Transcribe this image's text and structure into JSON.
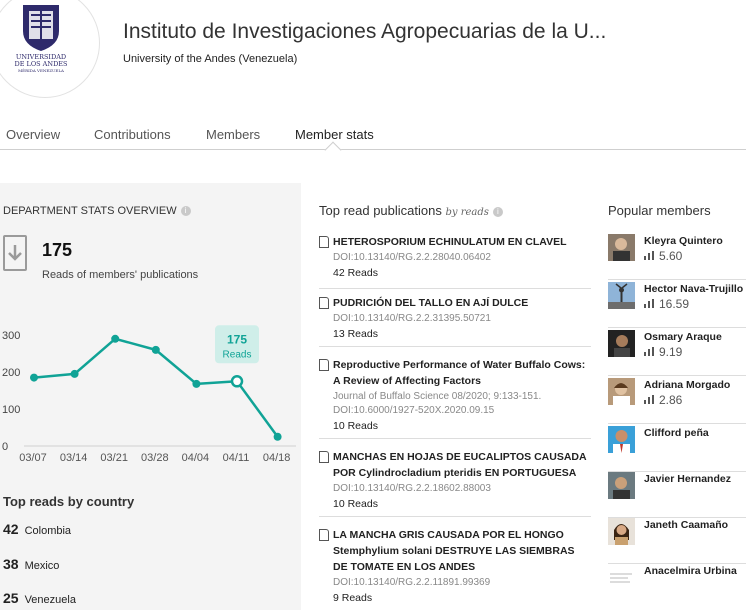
{
  "header": {
    "title": "Instituto de Investigaciones Agropecuarias de la U...",
    "subtitle": "University of the Andes (Venezuela)",
    "logo_text": [
      "UNIVERSIDAD",
      "DE LOS ANDES",
      "MÉRIDA VENEZUELA"
    ]
  },
  "tabs": [
    {
      "label": "Overview"
    },
    {
      "label": "Contributions"
    },
    {
      "label": "Members"
    },
    {
      "label": "Member stats",
      "active": true
    }
  ],
  "stats": {
    "heading": "DEPARTMENT STATS OVERVIEW",
    "total": "175",
    "total_label": "Reads of members' publications"
  },
  "chart_data": {
    "type": "line",
    "categories": [
      "03/07",
      "03/14",
      "03/21",
      "03/28",
      "04/04",
      "04/11",
      "04/18"
    ],
    "x": [
      0,
      1,
      2,
      3,
      4,
      5,
      6,
      7,
      8
    ],
    "values": [
      185,
      195,
      290,
      260,
      168,
      175,
      25
    ],
    "points_x": [
      0,
      1,
      2,
      3,
      4,
      5,
      6
    ],
    "yticks": [
      0,
      100,
      200,
      300
    ],
    "ylim": [
      0,
      330
    ],
    "highlight": {
      "index": 5,
      "value": "175",
      "label": "Reads"
    },
    "line_color": "#10a396"
  },
  "countries": {
    "heading": "Top reads by country",
    "items": [
      {
        "count": "42",
        "name": "Colombia"
      },
      {
        "count": "38",
        "name": "Mexico"
      },
      {
        "count": "25",
        "name": "Venezuela"
      }
    ]
  },
  "publications": {
    "heading": "Top read publications",
    "heading_sub": "by reads",
    "items": [
      {
        "title": "HETEROSPORIUM ECHINULATUM EN CLAVEL",
        "meta": "DOI:10.13140/RG.2.2.28040.06402",
        "reads": "42 Reads"
      },
      {
        "title": "PUDRICIÓN DEL TALLO EN AJÍ DULCE",
        "meta": "DOI:10.13140/RG.2.2.31395.50721",
        "reads": "13 Reads"
      },
      {
        "title": "Reproductive Performance of Water Buffalo Cows: A Review of Affecting Factors",
        "meta": "Journal of Buffalo Science 08/2020; 9:133-151. DOI:10.6000/1927-520X.2020.09.15",
        "reads": "10 Reads"
      },
      {
        "title": "MANCHAS EN HOJAS DE EUCALIPTOS CAUSADA POR Cylindrocladium pteridis EN PORTUGUESA",
        "meta": "DOI:10.13140/RG.2.2.18602.88003",
        "reads": "10 Reads"
      },
      {
        "title": "LA MANCHA GRIS CAUSADA POR EL HONGO Stemphylium solani DESTRUYE LAS SIEMBRAS DE TOMATE EN LOS ANDES",
        "meta": "DOI:10.13140/RG.2.2.11891.99369",
        "reads": "9 Reads"
      }
    ]
  },
  "members": {
    "heading": "Popular members",
    "items": [
      {
        "name": "Kleyra Quintero",
        "score": "5.60"
      },
      {
        "name": "Hector Nava-Trujillo",
        "score": "16.59"
      },
      {
        "name": "Osmary Araque",
        "score": "9.19"
      },
      {
        "name": "Adriana Morgado",
        "score": "2.86"
      },
      {
        "name": "Clifford peña",
        "score": ""
      },
      {
        "name": "Javier Hernandez",
        "score": ""
      },
      {
        "name": "Janeth Caamaño",
        "score": ""
      },
      {
        "name": "Anacelmira Urbina",
        "score": ""
      }
    ]
  }
}
